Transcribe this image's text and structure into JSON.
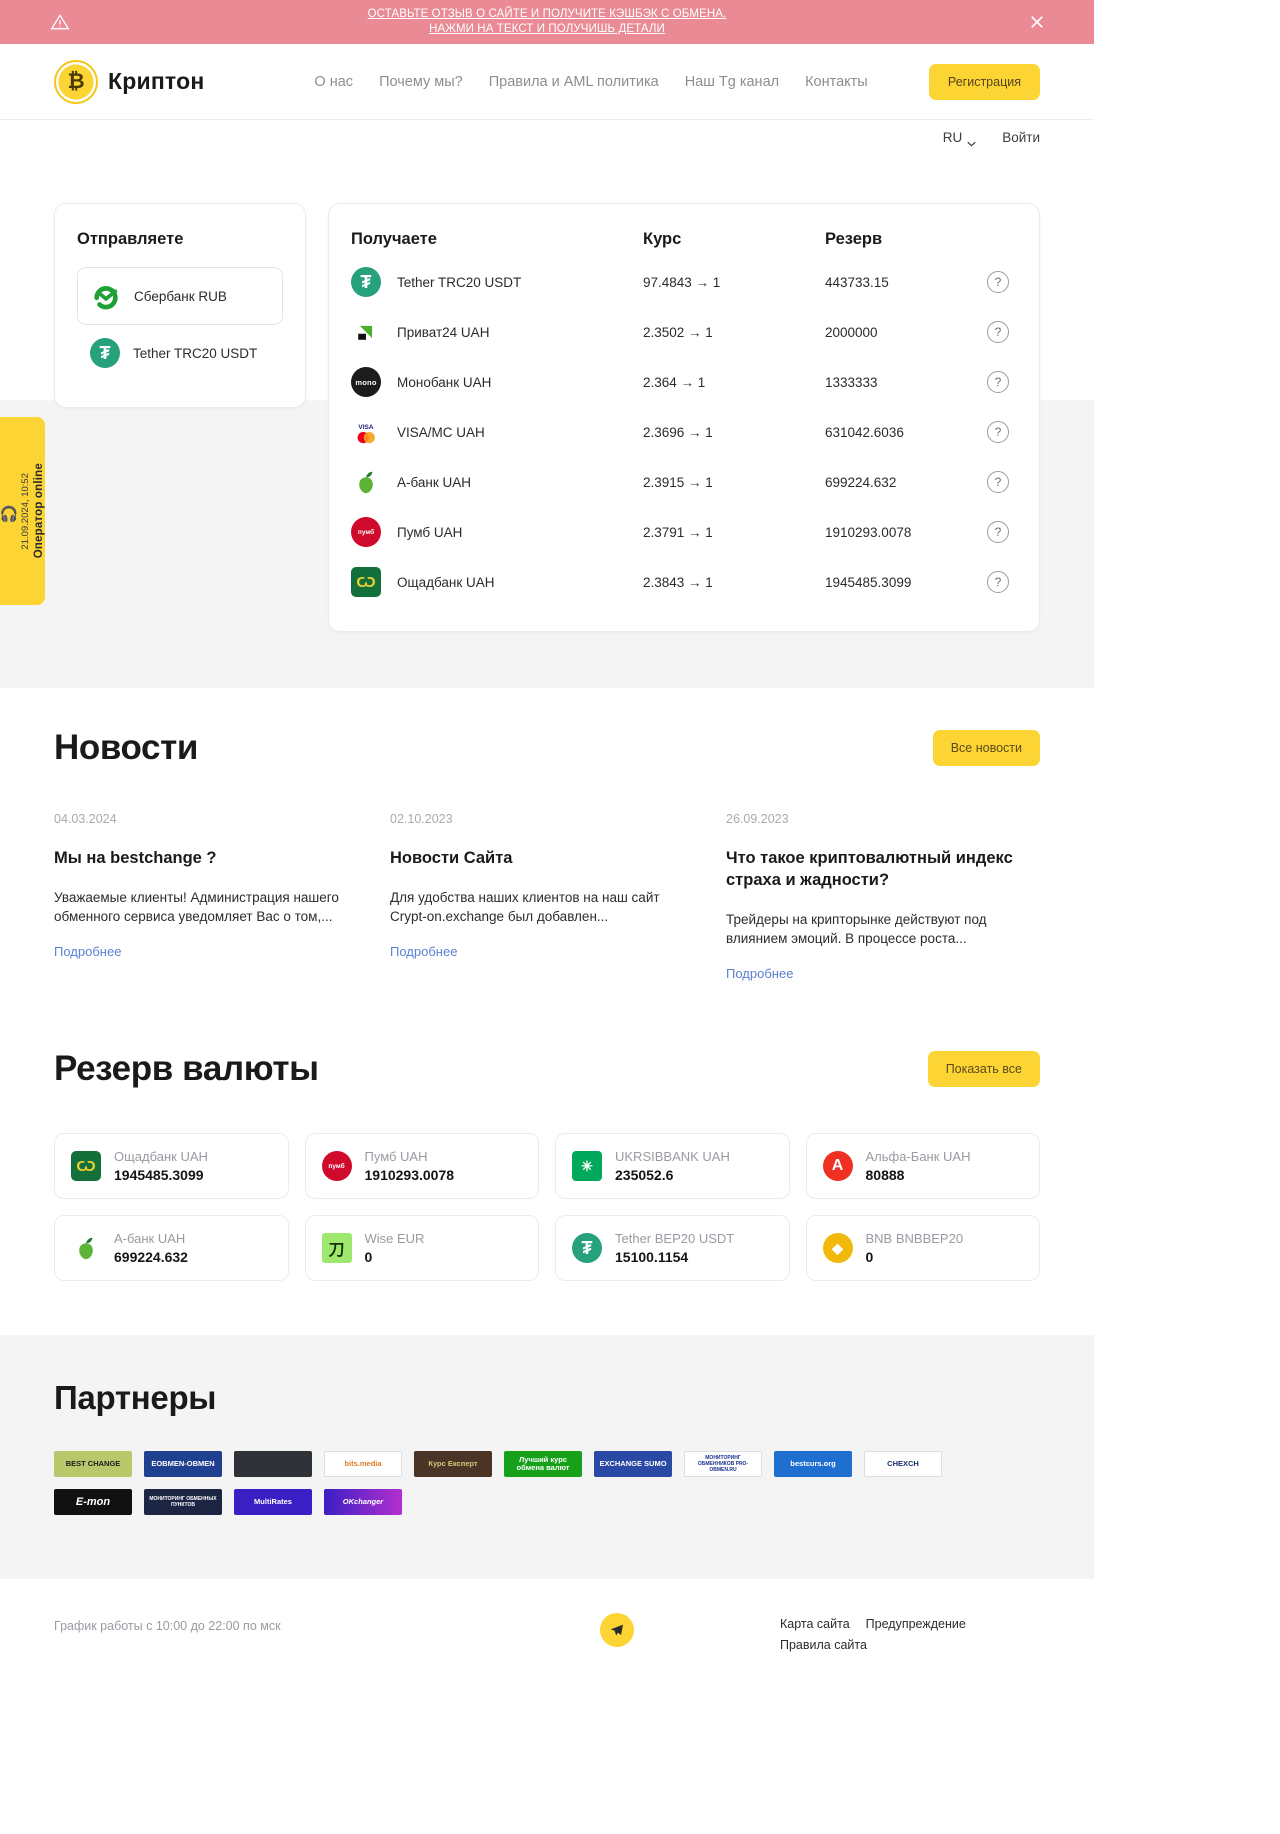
{
  "announcement": {
    "line1": "ОСТАВЬТЕ ОТЗЫВ О САЙТЕ И ПОЛУЧИТЕ КЭШБЭК С ОБМЕНА.",
    "line2": "НАЖМИ НА ТЕКСТ И ПОЛУЧИШЬ ДЕТАЛИ",
    "warning_icon": "warning-triangle-icon",
    "close_icon": "close-icon",
    "bg_color": "#e98a95"
  },
  "header": {
    "brand": {
      "name": "Криптон",
      "mark": "bitcoin-icon"
    },
    "nav": [
      {
        "label": "О нас"
      },
      {
        "label": "Почему мы?"
      },
      {
        "label": "Правила и AML политика"
      },
      {
        "label": "Наш Tg канал"
      },
      {
        "label": "Контакты"
      }
    ],
    "register_label": "Регистрация",
    "accent_color": "#fcd535"
  },
  "subheader": {
    "language": "RU",
    "login_label": "Войти"
  },
  "operator_badge": {
    "status": "Оператор online",
    "timestamp": "21.09.2024, 10:52",
    "icon": "operator-headset-icon"
  },
  "exchange": {
    "send": {
      "title": "Отправляете",
      "items": [
        {
          "label": "Сбербанк RUB",
          "icon": "sberbank-icon",
          "selected": true
        },
        {
          "label": "Tether TRC20 USDT",
          "icon": "tether-icon",
          "selected": false
        }
      ]
    },
    "receive": {
      "columns": {
        "currency": "Получаете",
        "rate": "Курс",
        "reserve": "Резерв"
      },
      "help_icon": "question-mark-icon",
      "rows": [
        {
          "currency": "Tether TRC20 USDT",
          "icon": "tether-icon",
          "rate": "97.4843 → 1",
          "reserve": "443733.15"
        },
        {
          "currency": "Приват24 UAH",
          "icon": "privat24-icon",
          "rate": "2.3502 → 1",
          "reserve": "2000000"
        },
        {
          "currency": "Монобанк UAH",
          "icon": "monobank-icon",
          "rate": "2.364 → 1",
          "reserve": "1333333"
        },
        {
          "currency": "VISA/MC UAH",
          "icon": "visa-mastercard-icon",
          "rate": "2.3696 → 1",
          "reserve": "631042.6036"
        },
        {
          "currency": "А-банк UAH",
          "icon": "abank-icon",
          "rate": "2.3915 → 1",
          "reserve": "699224.632"
        },
        {
          "currency": "Пумб UAH",
          "icon": "pumb-icon",
          "rate": "2.3791 → 1",
          "reserve": "1910293.0078"
        },
        {
          "currency": "Ощадбанк UAH",
          "icon": "oschadbank-icon",
          "rate": "2.3843 → 1",
          "reserve": "1945485.3099"
        }
      ]
    }
  },
  "news": {
    "title": "Новости",
    "all_button": "Все новости",
    "more_label": "Подробнее",
    "items": [
      {
        "date": "04.03.2024",
        "title": "Мы на bestchange ?",
        "excerpt": "Уважаемые клиенты! Администрация нашего обменного сервиса уведомляет Вас о том,...",
        "more": "Подробнее"
      },
      {
        "date": "02.10.2023",
        "title": "Новости Сайта",
        "excerpt": "Для удобства наших клиентов на наш сайт Crypt-on.exchange был добавлен...",
        "more": "Подробнее"
      },
      {
        "date": "26.09.2023",
        "title": "Что такое криптовалютный индекс страха и жадности?",
        "excerpt": "Трейдеры на крипторынке действуют под влиянием эмоций. В процессе роста...",
        "more": "Подробнее"
      }
    ]
  },
  "reserves": {
    "title": "Резерв валюты",
    "show_all_button": "Показать все",
    "items": [
      {
        "name": "Ощадбанк UAH",
        "amount": "1945485.3099",
        "icon": "oschadbank-icon"
      },
      {
        "name": "Пумб UAH",
        "amount": "1910293.0078",
        "icon": "pumb-icon"
      },
      {
        "name": "UKRSIBBANK UAH",
        "amount": "235052.6",
        "icon": "ukrsibbank-icon"
      },
      {
        "name": "Альфа-Банк UAH",
        "amount": "80888",
        "icon": "alfabank-icon"
      },
      {
        "name": "А-банк UAH",
        "amount": "699224.632",
        "icon": "abank-icon"
      },
      {
        "name": "Wise EUR",
        "amount": "0",
        "icon": "wise-icon"
      },
      {
        "name": "Tether BEP20 USDT",
        "amount": "15100.1154",
        "icon": "tether-icon"
      },
      {
        "name": "BNB BNBBEP20",
        "amount": "0",
        "icon": "bnb-icon"
      }
    ]
  },
  "partners": {
    "title": "Партнеры",
    "logos": [
      {
        "label": "BEST CHANGE",
        "bg": "#b7c96a",
        "fg": "#1b1b1b"
      },
      {
        "label": "EOBMEN-OBMEN",
        "bg": "#1f3f8f",
        "fg": "#ffffff"
      },
      {
        "label": "",
        "bg": "#2f3237",
        "fg": "#ffffff"
      },
      {
        "label": "bits.media",
        "bg": "#ffffff",
        "fg": "#e07b24"
      },
      {
        "label": "Курс Експерт",
        "bg": "#4a3426",
        "fg": "#d9c27a"
      },
      {
        "label": "Лучший курс обмена валют",
        "bg": "#17a01a",
        "fg": "#ffffff"
      },
      {
        "label": "EXCHANGE SUMO",
        "bg": "#2a49a4",
        "fg": "#ffffff"
      },
      {
        "label": "МОНИТОРИНГ ОБМЕННИКОВ PRO-OBMEN.RU",
        "bg": "#ffffff",
        "fg": "#1a2f8f"
      },
      {
        "label": "bestcurs.org",
        "bg": "#1f6fd0",
        "fg": "#ffffff"
      },
      {
        "label": "CHEXCH",
        "bg": "#ffffff",
        "fg": "#1a2f6f"
      },
      {
        "label": "E-mon",
        "bg": "#111111",
        "fg": "#ffffff"
      },
      {
        "label": "МОНИТОРИНГ ОБМЕННЫХ ПУНКТОВ",
        "bg": "#1d2545",
        "fg": "#ffffff"
      },
      {
        "label": "MultiRates",
        "bg": "#3a1fc4",
        "fg": "#ffffff"
      },
      {
        "label": "OKchanger",
        "bg": "#8a2fd0",
        "fg": "#ffffff"
      }
    ]
  },
  "footer": {
    "schedule": "График работы с 10:00 до 22:00 по мск",
    "telegram_icon": "telegram-icon",
    "links": [
      {
        "label": "Карта сайта"
      },
      {
        "label": "Предупреждение"
      },
      {
        "label": "Правила сайта"
      }
    ]
  }
}
